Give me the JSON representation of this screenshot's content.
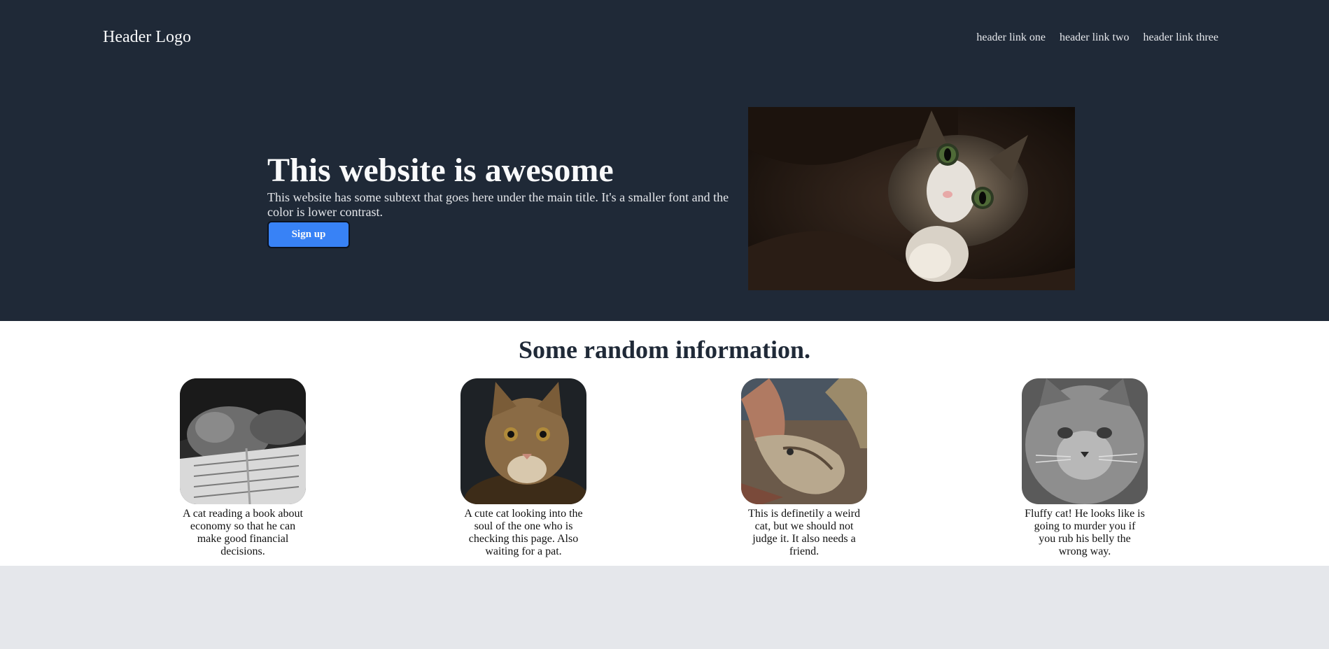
{
  "header": {
    "logo": "Header Logo",
    "links": [
      "header link one",
      "header link two",
      "header link three"
    ]
  },
  "hero": {
    "title": "This website is awesome",
    "subtitle": "This website has some subtext that goes here under the main title. It's a smaller font and the color is lower contrast.",
    "button_label": "Sign up",
    "image_icon": "cat-photo"
  },
  "info": {
    "title": "Some random information.",
    "cards": [
      {
        "caption": "A cat reading a book about economy so that he can make good financial decisions.",
        "icon": "cat-reading-photo"
      },
      {
        "caption": "A cute cat looking into the soul of the one who is checking this page. Also waiting for a pat.",
        "icon": "cat-portrait-photo"
      },
      {
        "caption": "This is definetily a weird cat, but we should not judge it. It also needs a friend.",
        "icon": "crocodile-photo"
      },
      {
        "caption": "Fluffy cat! He looks like is going to murder you if you rub his belly the wrong way.",
        "icon": "fluffy-cat-photo"
      }
    ]
  },
  "colors": {
    "header_bg": "#1f2937",
    "accent": "#3882f6",
    "footer_bg": "#e5e7eb"
  }
}
